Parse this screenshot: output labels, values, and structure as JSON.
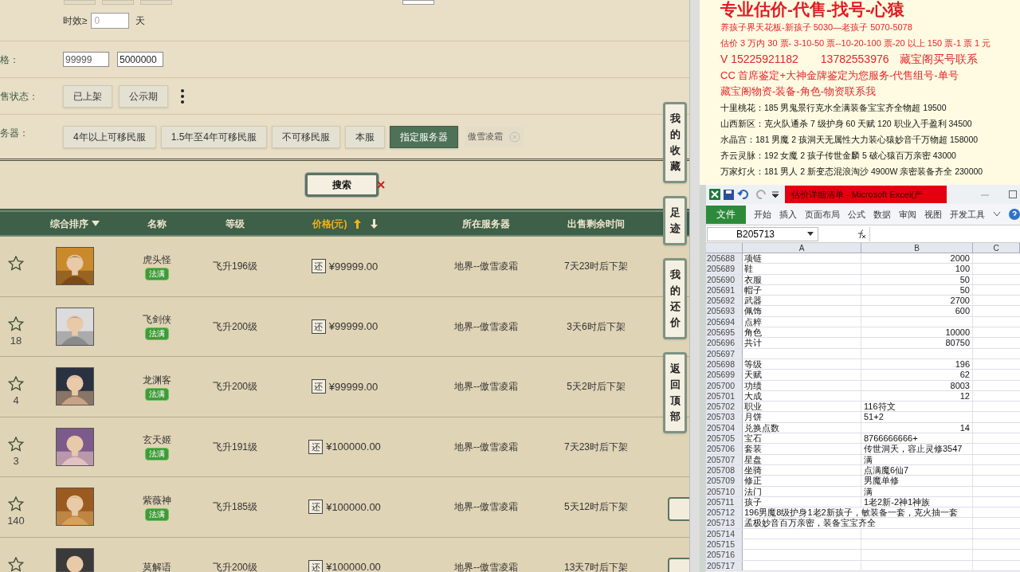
{
  "filters": {
    "validity": {
      "label": "时效≥",
      "placeholder": "0",
      "unit": "天"
    },
    "price": {
      "label": "格：",
      "min": "99999",
      "max": "5000000"
    },
    "sale_status": {
      "label": "售状态：",
      "options": [
        {
          "label": "已上架",
          "selected": false
        },
        {
          "label": "公示期",
          "selected": false
        }
      ]
    },
    "server": {
      "label": "务器：",
      "options": [
        {
          "label": "4年以上可移民服",
          "selected": false
        },
        {
          "label": "1.5年至4年可移民服",
          "selected": false
        },
        {
          "label": "不可移民服",
          "selected": false
        },
        {
          "label": "本服",
          "selected": false
        },
        {
          "label": "指定服务器",
          "selected": true
        }
      ],
      "chosen": "傲雪凌霜"
    }
  },
  "search_button": "搜索",
  "table": {
    "columns": [
      {
        "label": "综合排序",
        "kind": "dropdown",
        "selected": false
      },
      {
        "label": "名称",
        "kind": "plain",
        "selected": false
      },
      {
        "label": "等级",
        "kind": "plain",
        "selected": false
      },
      {
        "label": "价格(元)",
        "kind": "sort",
        "selected": true
      },
      {
        "label": "所在服务器",
        "kind": "plain",
        "selected": false
      },
      {
        "label": "出售剩余时间",
        "kind": "plain",
        "selected": false
      }
    ],
    "rows": [
      {
        "favorites": "",
        "name": "虎头怪",
        "badge": "法满",
        "level": "飞升196级",
        "tag": "还",
        "price": "¥99999.00",
        "server": "地界--傲雪凌霜",
        "time_left": "7天23时后下架"
      },
      {
        "favorites": "18",
        "name": "飞剑侠",
        "badge": "法满",
        "level": "飞升200级",
        "tag": "还",
        "price": "¥99999.00",
        "server": "地界--傲雪凌霜",
        "time_left": "3天6时后下架"
      },
      {
        "favorites": "4",
        "name": "龙渊客",
        "badge": "法满",
        "level": "飞升200级",
        "tag": "还",
        "price": "¥99999.00",
        "server": "地界--傲雪凌霜",
        "time_left": "5天2时后下架"
      },
      {
        "favorites": "3",
        "name": "玄天姬",
        "badge": "法满",
        "level": "飞升191级",
        "tag": "还",
        "price": "¥100000.00",
        "server": "地界--傲雪凌霜",
        "time_left": "7天23时后下架"
      },
      {
        "favorites": "140",
        "name": "紫薇神",
        "badge": "法满",
        "level": "飞升185级",
        "tag": "还",
        "price": "¥100000.00",
        "server": "地界--傲雪凌霜",
        "time_left": "5天12时后下架"
      },
      {
        "favorites": "",
        "name": "莫解语",
        "badge": "",
        "level": "飞升200级",
        "tag": "还",
        "price": "¥100000.00",
        "server": "地界--傲雪凌霜",
        "time_left": "13天7时后下架"
      }
    ]
  },
  "side_buttons": [
    "我的收藏",
    "足迹",
    "我的还价",
    "返回顶部"
  ],
  "ad": {
    "title": "专业估价-代售-找号-心猿",
    "lines": [
      {
        "kind": "red_small",
        "text": "养孩子界天花板-新孩子 5030—老孩子 5070-5078"
      },
      {
        "kind": "red_small",
        "text": "估价 3 万内 30 票- 3-10-50 票--10-20-100 票-20 以上 150 票-1 票 1 元"
      },
      {
        "kind": "red_large",
        "text": "V 15225921182　　13782553976　藏宝阁买号联系"
      },
      {
        "kind": "red_medium",
        "text": "CC 首席鉴定+大神金牌鉴定为您服务-代售组号-单号"
      },
      {
        "kind": "red_medium",
        "text": "藏宝阁物资-装备-角色-物资联系我"
      },
      {
        "kind": "black",
        "text": "十里桃花：185 男鬼景行克水全满装备宝宝齐全物超 19500"
      },
      {
        "kind": "black",
        "text": "山西新区：克火队通杀 7 级护身 60 天赋 120 职业入手盈利 34500"
      },
      {
        "kind": "black",
        "text": "水晶宫：181 男魔 2 孩洞天无属性大力装心猿妙音千万物超 158000"
      },
      {
        "kind": "black",
        "text": "齐云灵脉：192 女魔 2 孩子传世金麟 5 破心猿百万亲密 43000"
      },
      {
        "kind": "black",
        "text": "万家灯火：181 男人 2 新变态混浪淘沙 4900W 亲密装备齐全 230000"
      }
    ]
  },
  "excel": {
    "title": "估价详细清单 - Microsoft Excel(产",
    "ribbon_tabs": [
      {
        "label": "文件",
        "selected": true
      },
      {
        "label": "开始",
        "selected": false
      },
      {
        "label": "插入",
        "selected": false
      },
      {
        "label": "页面布局",
        "selected": false
      },
      {
        "label": "公式",
        "selected": false
      },
      {
        "label": "数据",
        "selected": false
      },
      {
        "label": "审阅",
        "selected": false
      },
      {
        "label": "视图",
        "selected": false
      },
      {
        "label": "开发工具",
        "selected": false
      }
    ],
    "name_box": "B205713",
    "columns": [
      "A",
      "B",
      "C"
    ],
    "rows": [
      {
        "row": "205688",
        "a": "项链",
        "b": "2000",
        "kind": "number"
      },
      {
        "row": "205689",
        "a": "鞋",
        "b": "100",
        "kind": "number"
      },
      {
        "row": "205690",
        "a": "衣服",
        "b": "50",
        "kind": "number"
      },
      {
        "row": "205691",
        "a": "帽子",
        "b": "50",
        "kind": "number"
      },
      {
        "row": "205692",
        "a": "武器",
        "b": "2700",
        "kind": "number"
      },
      {
        "row": "205693",
        "a": "佩饰",
        "b": "600",
        "kind": "number"
      },
      {
        "row": "205694",
        "a": "点粹",
        "b": "",
        "kind": "number"
      },
      {
        "row": "205695",
        "a": "角色",
        "b": "10000",
        "kind": "number"
      },
      {
        "row": "205696",
        "a": "共计",
        "b": "80750",
        "kind": "number"
      },
      {
        "row": "205697",
        "a": "",
        "b": "",
        "kind": "number"
      },
      {
        "row": "205698",
        "a": "等级",
        "b": "196",
        "kind": "number"
      },
      {
        "row": "205699",
        "a": "天赋",
        "b": "62",
        "kind": "number"
      },
      {
        "row": "205700",
        "a": "功绩",
        "b": "8003",
        "kind": "number"
      },
      {
        "row": "205701",
        "a": "大成",
        "b": "12",
        "kind": "number"
      },
      {
        "row": "205702",
        "a": "职业",
        "b": "116符文",
        "kind": "text"
      },
      {
        "row": "205703",
        "a": "月饼",
        "b": "51+2",
        "kind": "text"
      },
      {
        "row": "205704",
        "a": "兑换点数",
        "b": "14",
        "kind": "number"
      },
      {
        "row": "205705",
        "a": "宝石",
        "b": "8766666666+",
        "kind": "text"
      },
      {
        "row": "205706",
        "a": "套装",
        "b": "传世洞天，容止灵修3547",
        "kind": "text"
      },
      {
        "row": "205707",
        "a": "星盘",
        "b": "满",
        "kind": "text"
      },
      {
        "row": "205708",
        "a": "坐骑",
        "b": "点满魔6仙7",
        "kind": "text"
      },
      {
        "row": "205709",
        "a": "修正",
        "b": "男魔单修",
        "kind": "text"
      },
      {
        "row": "205710",
        "a": "法门",
        "b": "满",
        "kind": "text"
      },
      {
        "row": "205711",
        "a": "孩子",
        "b": "1老2新-2神1神族",
        "kind": "text"
      },
      {
        "row": "205712",
        "a": "196男魔8级护身1老2新孩子，敏装备一套，克火抽一套",
        "b": "",
        "kind": "text"
      },
      {
        "row": "205713",
        "a": "孟极妙音百万亲密，装备宝宝齐全",
        "b": "",
        "kind": "text"
      },
      {
        "row": "205714",
        "a": "",
        "b": "",
        "kind": "text"
      },
      {
        "row": "205715",
        "a": "",
        "b": "",
        "kind": "text"
      },
      {
        "row": "205716",
        "a": "",
        "b": "",
        "kind": "text"
      },
      {
        "row": "205717",
        "a": "",
        "b": "",
        "kind": "text"
      }
    ]
  }
}
